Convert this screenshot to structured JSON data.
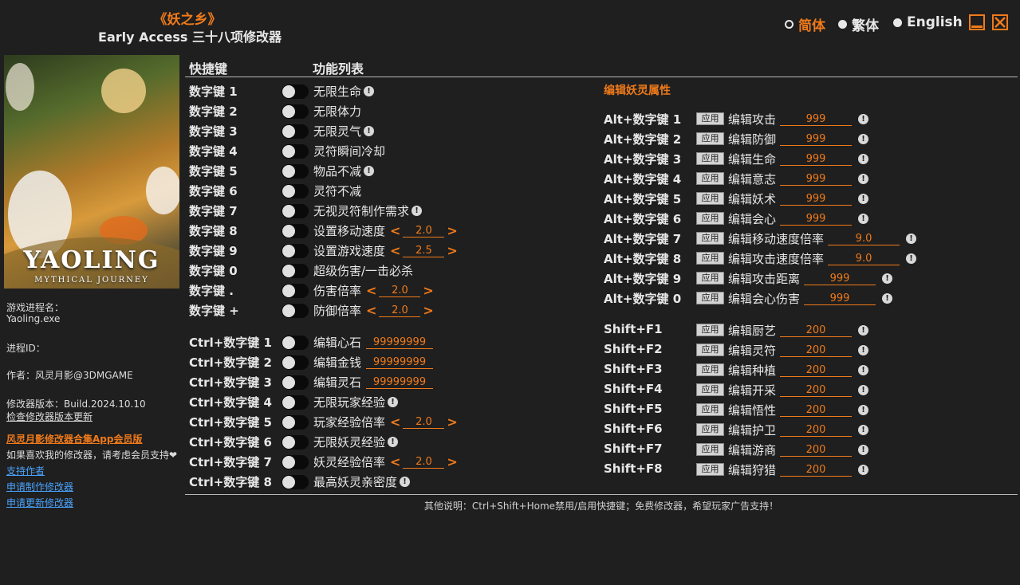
{
  "header": {
    "title_cn": "《妖之乡》",
    "title_en": "Early Access 三十八项修改器",
    "languages": [
      {
        "label": "简体",
        "active": true
      },
      {
        "label": "繁体",
        "active": false
      },
      {
        "label": "English",
        "active": false
      }
    ]
  },
  "cover": {
    "logo": "YAOLING",
    "logo_sub": "MYTHICAL JOURNEY"
  },
  "sidebar": {
    "process_name_label": "游戏进程名：",
    "process_name": "Yaoling.exe",
    "process_id_label": "进程ID：",
    "author": "作者：风灵月影@3DMGAME",
    "version": "修改器版本：Build.2024.10.10",
    "check_update": "检查修改器版本更新",
    "promo": "风灵月影修改器合集App会员版",
    "support_text": "如果喜欢我的修改器，请考虑会员支持❤",
    "link_support": "支持作者",
    "link_request": "申请制作修改器",
    "link_update": "申请更新修改器"
  },
  "columns": {
    "hotkey": "快捷键",
    "features": "功能列表"
  },
  "info_icon": "!",
  "left_rows": [
    {
      "key": "数字键 1",
      "label": "无限生命",
      "info": true
    },
    {
      "key": "数字键 2",
      "label": "无限体力"
    },
    {
      "key": "数字键 3",
      "label": "无限灵气",
      "info": true
    },
    {
      "key": "数字键 4",
      "label": "灵符瞬间冷却"
    },
    {
      "key": "数字键 5",
      "label": "物品不减",
      "info": true
    },
    {
      "key": "数字键 6",
      "label": "灵符不减"
    },
    {
      "key": "数字键 7",
      "label": "无视灵符制作需求",
      "info": true
    },
    {
      "key": "数字键 8",
      "label": "设置移动速度",
      "stepper": "2.0"
    },
    {
      "key": "数字键 9",
      "label": "设置游戏速度",
      "stepper": "2.5"
    },
    {
      "key": "数字键 0",
      "label": "超级伤害/一击必杀"
    },
    {
      "key": "数字键 .",
      "label": "伤害倍率",
      "stepper": "2.0"
    },
    {
      "key": "数字键 +",
      "label": "防御倍率",
      "stepper": "2.0"
    },
    {
      "key": "Ctrl+数字键 1",
      "label": "编辑心石",
      "edit": "99999999"
    },
    {
      "key": "Ctrl+数字键 2",
      "label": "编辑金钱",
      "edit": "99999999"
    },
    {
      "key": "Ctrl+数字键 3",
      "label": "编辑灵石",
      "edit": "99999999"
    },
    {
      "key": "Ctrl+数字键 4",
      "label": "无限玩家经验",
      "info": true
    },
    {
      "key": "Ctrl+数字键 5",
      "label": "玩家经验倍率",
      "stepper": "2.0"
    },
    {
      "key": "Ctrl+数字键 6",
      "label": "无限妖灵经验",
      "info": true
    },
    {
      "key": "Ctrl+数字键 7",
      "label": "妖灵经验倍率",
      "stepper": "2.0"
    },
    {
      "key": "Ctrl+数字键 8",
      "label": "最高妖灵亲密度",
      "info": true
    }
  ],
  "right_section_title": "编辑妖灵属性",
  "apply_label": "应用",
  "right_rows": [
    {
      "key": "Alt+数字键 1",
      "label": "编辑攻击",
      "value": "999"
    },
    {
      "key": "Alt+数字键 2",
      "label": "编辑防御",
      "value": "999"
    },
    {
      "key": "Alt+数字键 3",
      "label": "编辑生命",
      "value": "999"
    },
    {
      "key": "Alt+数字键 4",
      "label": "编辑意志",
      "value": "999"
    },
    {
      "key": "Alt+数字键 5",
      "label": "编辑妖术",
      "value": "999"
    },
    {
      "key": "Alt+数字键 6",
      "label": "编辑会心",
      "value": "999"
    },
    {
      "key": "Alt+数字键 7",
      "label": "编辑移动速度倍率",
      "value": "9.0"
    },
    {
      "key": "Alt+数字键 8",
      "label": "编辑攻击速度倍率",
      "value": "9.0"
    },
    {
      "key": "Alt+数字键 9",
      "label": "编辑攻击距离",
      "value": "999"
    },
    {
      "key": "Alt+数字键 0",
      "label": "编辑会心伤害",
      "value": "999"
    },
    {
      "key": "Shift+F1",
      "label": "编辑厨艺",
      "value": "200"
    },
    {
      "key": "Shift+F2",
      "label": "编辑灵符",
      "value": "200"
    },
    {
      "key": "Shift+F3",
      "label": "编辑种植",
      "value": "200"
    },
    {
      "key": "Shift+F4",
      "label": "编辑开采",
      "value": "200"
    },
    {
      "key": "Shift+F5",
      "label": "编辑悟性",
      "value": "200"
    },
    {
      "key": "Shift+F6",
      "label": "编辑护卫",
      "value": "200"
    },
    {
      "key": "Shift+F7",
      "label": "编辑游商",
      "value": "200"
    },
    {
      "key": "Shift+F8",
      "label": "编辑狩猎",
      "value": "200"
    }
  ],
  "footer": "其他说明：Ctrl+Shift+Home禁用/启用快捷键；免费修改器，希望玩家广告支持！",
  "colors": {
    "accent": "#f07a1a",
    "background": "#1f1f1f",
    "link": "#4aa3ff"
  }
}
